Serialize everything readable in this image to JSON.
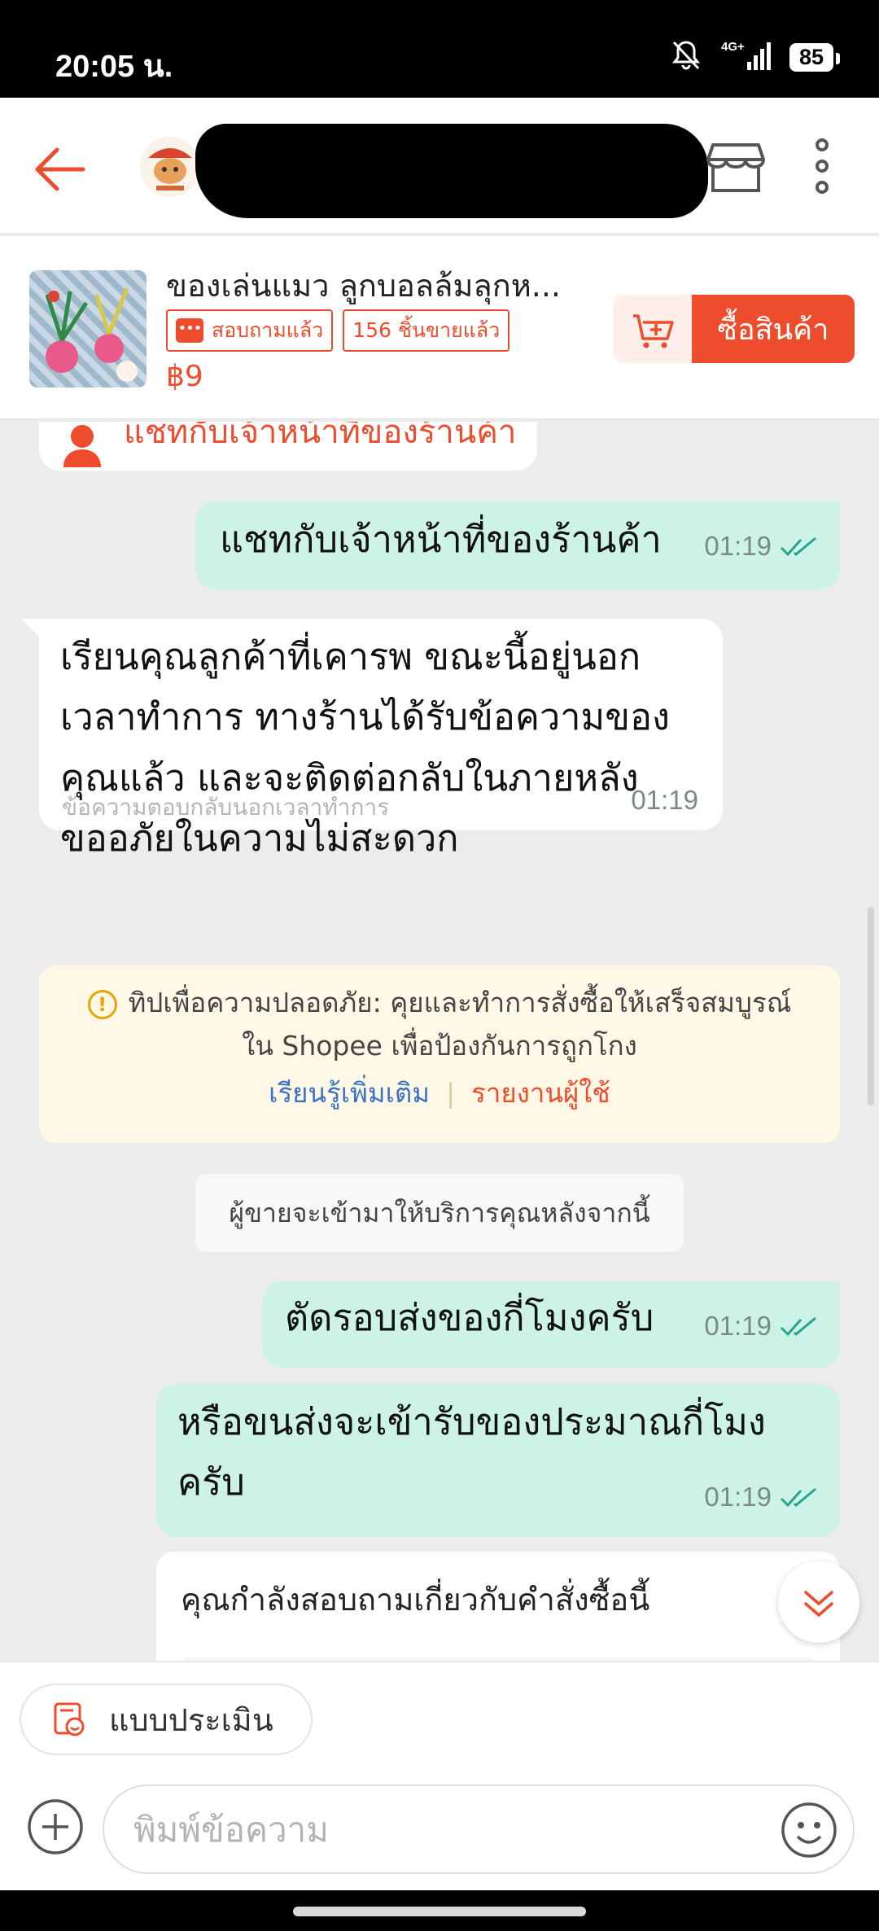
{
  "status_bar": {
    "time": "20:05 น.",
    "network": "4G+",
    "battery": "85"
  },
  "header": {
    "shop_name": ""
  },
  "product": {
    "title": "ของเล่นแมว ลูกบอลล้มลุกห...",
    "tag_inquired": "สอบถามแล้ว",
    "tag_sold": "156 ชิ้นขายแล้ว",
    "price": "฿9",
    "buy_label": "ซื้อสินค้า"
  },
  "chat": {
    "partial_prev_label": "แชทกับเจ้าหน้าที่ของร้านค้า",
    "messages": [
      {
        "direction": "out",
        "text": "แชทกับเจ้าหน้าที่ของร้านค้า",
        "time": "01:19"
      },
      {
        "direction": "in",
        "lines": [
          "เรียนคุณลูกค้าที่เคารพ ขณะนี้อยู่นอก",
          "เวลาทำการ ทางร้านได้รับข้อความของ",
          "คุณแล้ว และจะติดต่อกลับในภายหลัง",
          "ขออภัยในความไม่สะดวก"
        ],
        "note": "ข้อความตอบกลับนอกเวลาทำการ",
        "time": "01:19"
      },
      {
        "direction": "out",
        "text": "ตัดรอบส่งของกี่โมงครับ",
        "time": "01:19"
      },
      {
        "direction": "out",
        "lines": [
          "หรือขนส่งจะเข้ารับของประมาณกี่โมง",
          "ครับ"
        ],
        "time": "01:19"
      }
    ],
    "safety_tip": {
      "line1": "ทิปเพื่อความปลอดภัย: คุยและทำการสั่งซื้อให้เสร็จสมบูรณ์",
      "line2": "ใน Shopee เพื่อป้องกันการถูกโกง",
      "learn_more": "เรียนรู้เพิ่มเติม",
      "report_user": "รายงานผู้ใช้"
    },
    "system_note": "ผู้ขายจะเข้ามาให้บริการคุณหลังจากนี้",
    "order_card_title": "คุณกำลังสอบถามเกี่ยวกับคำสั่งซื้อนี้"
  },
  "bottom": {
    "rate_label": "แบบประเมิน",
    "input_placeholder": "พิมพ์ข้อความ"
  },
  "colors": {
    "brand": "#ee4d2d",
    "outgoing_bubble": "#cdf3e8",
    "tick": "#26a58a",
    "tip_bg": "#fff8e6"
  },
  "icons": [
    "back-arrow-icon",
    "store-icon",
    "more-vertical-icon",
    "cart-add-icon",
    "chat-icon",
    "double-check-icon",
    "warning-icon",
    "chevron-down-icon",
    "rating-icon",
    "plus-circle-icon",
    "emoji-icon"
  ]
}
